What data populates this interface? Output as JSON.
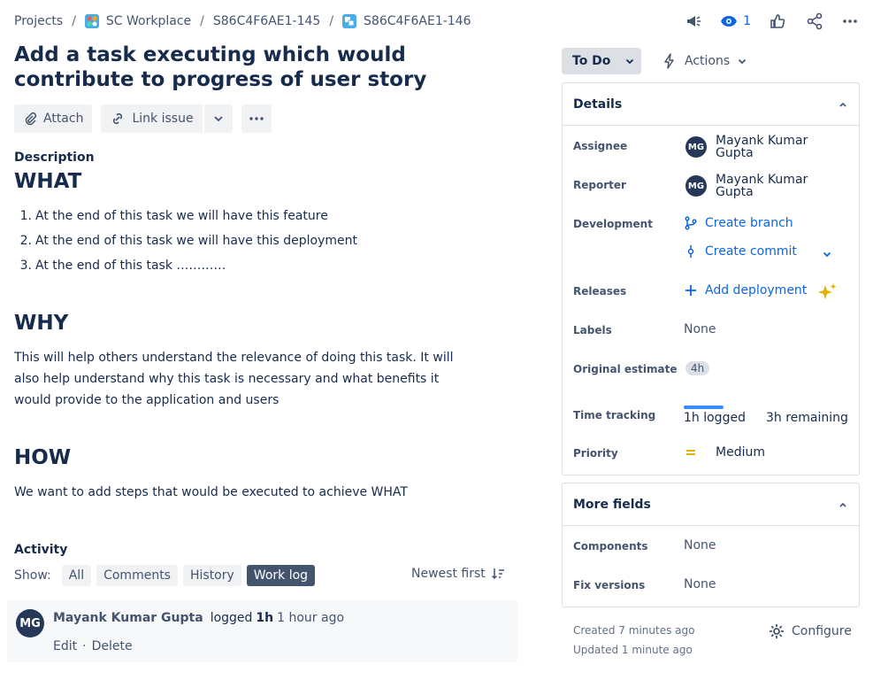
{
  "breadcrumb": {
    "projects": "Projects",
    "project": "SC Workplace",
    "parent": "S86C4F6AE1-145",
    "issue": "S86C4F6AE1-146"
  },
  "header": {
    "watch_count": "1"
  },
  "issue": {
    "title": "Add a task executing which would contribute to progress of user story"
  },
  "toolbar": {
    "attach": "Attach",
    "link_issue": "Link issue"
  },
  "description": {
    "label": "Description",
    "what_heading": "WHAT",
    "items": [
      {
        "num": "1.",
        "text": "At the end of this task we will have this feature"
      },
      {
        "num": "2.",
        "text": "At the end of this task we will have this deployment"
      },
      {
        "num": "3.",
        "text": "At the end of this task …………"
      }
    ],
    "why_heading": "WHY",
    "why_text": "This will help others understand the relevance of doing this task. It will also help understand why this task is necessary and what benefits it would provide to the application and users",
    "how_heading": "HOW",
    "how_text": "We want to add steps that would be executed to achieve WHAT"
  },
  "activity": {
    "label": "Activity",
    "show_label": "Show:",
    "filters": [
      "All",
      "Comments",
      "History",
      "Work log"
    ],
    "sort_label": "Newest first",
    "entry": {
      "initials": "MG",
      "author": "Mayank Kumar Gupta",
      "action": "logged",
      "amount": "1h",
      "time": "1 hour ago",
      "edit": "Edit",
      "dot": "·",
      "delete": "Delete"
    }
  },
  "status": {
    "label": "To Do",
    "actions_label": "Actions"
  },
  "details": {
    "title": "Details",
    "assignee_label": "Assignee",
    "assignee_initials": "MG",
    "assignee_name_line1": "Mayank Kumar",
    "assignee_name_line2": "Gupta",
    "reporter_label": "Reporter",
    "reporter_initials": "MG",
    "reporter_name_line1": "Mayank Kumar",
    "reporter_name_line2": "Gupta",
    "development_label": "Development",
    "create_branch": "Create branch",
    "create_commit": "Create commit",
    "releases_label": "Releases",
    "add_deployment": "Add deployment",
    "labels_label": "Labels",
    "labels_value": "None",
    "estimate_label": "Original estimate",
    "estimate_value": "4h",
    "tracking_label": "Time tracking",
    "logged": "1h logged",
    "remaining": "3h remaining",
    "tracking_fraction": 0.25,
    "priority_label": "Priority",
    "priority_value": "Medium"
  },
  "more_fields": {
    "title": "More fields",
    "components_label": "Components",
    "components_value": "None",
    "fix_versions_label": "Fix versions",
    "fix_versions_value": "None"
  },
  "meta": {
    "created": "Created 7 minutes ago",
    "updated": "Updated 1 minute ago",
    "configure": "Configure"
  },
  "colors": {
    "accent": "#0c66e4",
    "priority": "#e2b203",
    "ai": "#e2b203"
  }
}
